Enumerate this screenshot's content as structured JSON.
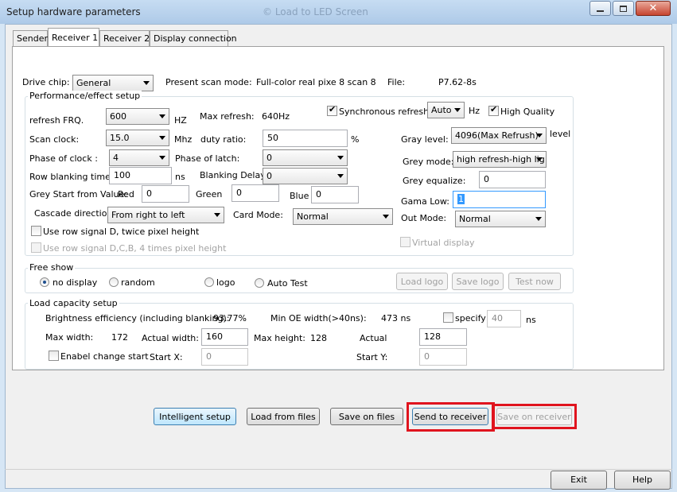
{
  "window": {
    "title": "Setup hardware parameters",
    "behind_title": "© Load to LED Screen"
  },
  "tabs": [
    "Sender",
    "Receiver 1",
    "Receiver 2",
    "Display connection"
  ],
  "header": {
    "drive_chip_label": "Drive chip:",
    "drive_chip_value": "General",
    "present_scan_mode_label": "Present scan mode:",
    "present_scan_mode_value": "Full-color real pixe 8 scan 8",
    "file_label": "File:",
    "file_value": "P7.62-8s"
  },
  "performance": {
    "group_title": "Performance/effect setup",
    "refresh_frq_label": "refresh FRQ.",
    "refresh_frq_value": "600",
    "refresh_frq_unit": "HZ",
    "max_refresh_label": "Max refresh:",
    "max_refresh_value": "640Hz",
    "sync_refresh_label": "Synchronous refresh",
    "sync_refresh_checked": true,
    "sync_mode_value": "Auto",
    "sync_unit": "Hz",
    "high_quality_label": "High Quality",
    "high_quality_checked": true,
    "scan_clock_label": "Scan clock:",
    "scan_clock_value": "15.0",
    "scan_clock_unit": "Mhz",
    "duty_ratio_label": "duty ratio:",
    "duty_ratio_value": "50",
    "duty_ratio_unit": "%",
    "gray_level_label": "Gray level:",
    "gray_level_value": "4096(Max Refrush)",
    "gray_level_unit": "level",
    "phase_clock_label": "Phase of clock :",
    "phase_clock_value": "4",
    "phase_latch_label": "Phase of latch:",
    "phase_latch_value": "0",
    "grey_mode_label": "Grey mode:",
    "grey_mode_value": "high refresh-high lig",
    "row_blanking_label": "Row blanking time:",
    "row_blanking_value": "100",
    "row_blanking_unit": "ns",
    "blanking_delay_label": "Blanking Delay:",
    "blanking_delay_value": "0",
    "grey_equalize_label": "Grey equalize:",
    "grey_equalize_value": "0",
    "grey_start_label": "Grey Start from Value:",
    "red_label": "Red",
    "red_value": "0",
    "green_label": "Green",
    "green_value": "0",
    "blue_label": "Blue",
    "blue_value": "0",
    "gama_low_label": "Gama Low:",
    "gama_low_value": "1",
    "cascade_label": "Cascade direction:",
    "cascade_value": "From right to left",
    "card_mode_label": "Card Mode:",
    "card_mode_value": "Normal",
    "out_mode_label": "Out Mode:",
    "out_mode_value": "Normal",
    "row_signal_d_label": "Use row signal D, twice pixel height",
    "row_signal_dcb_label": "Use row signal D,C,B, 4 times pixel height",
    "virtual_display_label": "Virtual display"
  },
  "free_show": {
    "group_title": "Free show",
    "options": [
      "no display",
      "random",
      "logo",
      "Auto Test"
    ],
    "selected": "no display",
    "load_logo_label": "Load logo",
    "save_logo_label": "Save logo",
    "test_now_label": "Test now"
  },
  "load_capacity": {
    "group_title": "Load capacity setup",
    "brightness_label": "Brightness efficiency (including blanking):",
    "brightness_value": "93.77%",
    "min_oe_label": "Min OE width(>40ns):",
    "min_oe_value": "473 ns",
    "specify_label": "specify",
    "specify_value": "40",
    "specify_unit": "ns",
    "max_width_label": "Max width:",
    "max_width_value": "172",
    "actual_width_label": "Actual width:",
    "actual_width_value": "160",
    "max_height_label": "Max height:",
    "max_height_value": "128",
    "actual_label": "Actual",
    "actual_height_value": "128",
    "enable_change_start_label": "Enabel change start",
    "start_x_label": "Start X:",
    "start_x_value": "0",
    "start_y_label": "Start Y:",
    "start_y_value": "0"
  },
  "actions": {
    "intelligent_setup": "Intelligent setup",
    "load_from_files": "Load from files",
    "save_on_files": "Save on files",
    "send_to_receiver": "Send to receiver",
    "save_on_receiver": "Save on receiver"
  },
  "footer": {
    "exit": "Exit",
    "help": "Help"
  },
  "colors": {
    "highlight": "#e0141e",
    "titlebar": "#b9d2ec",
    "default_button": "#bee6fd"
  }
}
